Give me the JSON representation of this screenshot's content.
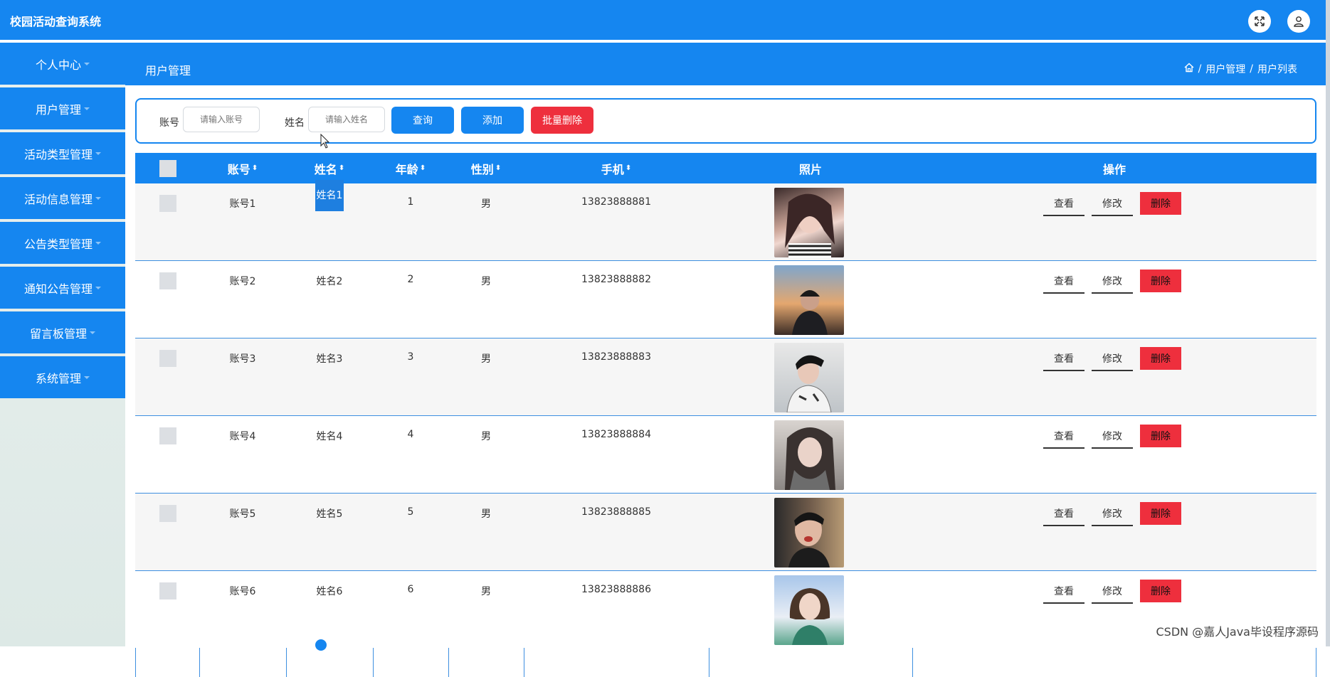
{
  "app": {
    "title": "校园活动查询系统"
  },
  "header": {
    "fullscreen_icon": "expand-icon",
    "user_icon": "user-icon"
  },
  "sidebar": {
    "items": [
      {
        "label": "个人中心"
      },
      {
        "label": "用户管理"
      },
      {
        "label": "活动类型管理"
      },
      {
        "label": "活动信息管理"
      },
      {
        "label": "公告类型管理"
      },
      {
        "label": "通知公告管理"
      },
      {
        "label": "留言板管理"
      },
      {
        "label": "系统管理"
      }
    ]
  },
  "page": {
    "section_title": "用户管理",
    "breadcrumb": {
      "home_icon": "home-icon",
      "sep": "/",
      "level1": "用户管理",
      "level2": "用户列表"
    }
  },
  "search": {
    "account_label": "账号",
    "account_placeholder": "请输入账号",
    "name_label": "姓名",
    "name_placeholder": "请输入姓名",
    "query_button": "查询",
    "add_button": "添加",
    "batch_delete_button": "批量删除"
  },
  "table": {
    "columns": [
      "账号",
      "姓名",
      "年龄",
      "性别",
      "手机",
      "照片",
      "操作"
    ],
    "sort_glyph": "⬍",
    "actions": {
      "view": "查看",
      "edit": "修改",
      "delete": "删除"
    },
    "rows": [
      {
        "account": "账号1",
        "name": "姓名1",
        "age": "1",
        "gender": "男",
        "phone": "13823888881"
      },
      {
        "account": "账号2",
        "name": "姓名2",
        "age": "2",
        "gender": "男",
        "phone": "13823888882"
      },
      {
        "account": "账号3",
        "name": "姓名3",
        "age": "3",
        "gender": "男",
        "phone": "13823888883"
      },
      {
        "account": "账号4",
        "name": "姓名4",
        "age": "4",
        "gender": "男",
        "phone": "13823888884"
      },
      {
        "account": "账号5",
        "name": "姓名5",
        "age": "5",
        "gender": "男",
        "phone": "13823888885"
      },
      {
        "account": "账号6",
        "name": "姓名6",
        "age": "6",
        "gender": "男",
        "phone": "13823888886"
      }
    ]
  },
  "watermark": "CSDN @嘉人Java毕设程序源码",
  "colors": {
    "primary": "#1586f0",
    "danger": "#ee2f3d"
  }
}
